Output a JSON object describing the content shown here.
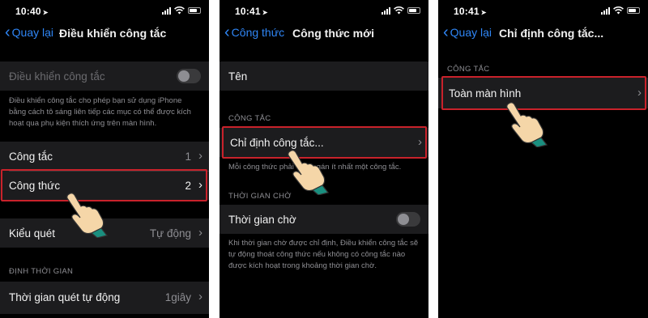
{
  "screen1": {
    "time": "10:40",
    "back": "Quay lại",
    "title": "Điều khiển công tắc",
    "switch_control_label": "Điều khiển công tắc",
    "description": "Điều khiển công tắc cho phép bạn sử dụng iPhone bằng cách tô sáng liên tiếp các mục có thể được kích hoạt qua phụ kiện thích ứng trên màn hình.",
    "switches_label": "Công tắc",
    "switches_value": "1",
    "recipes_label": "Công thức",
    "recipes_value": "2",
    "scan_style_label": "Kiểu quét",
    "scan_style_value": "Tự động",
    "timing_header": "ĐỊNH THỜI GIAN",
    "auto_scan_label": "Thời gian quét tự động",
    "auto_scan_value": "1giây"
  },
  "screen2": {
    "time": "10:41",
    "back": "Công thức",
    "title": "Công thức mới",
    "name_label": "Tên",
    "switch_header": "CÔNG TẮC",
    "assign_label": "Chỉ định công tắc...",
    "assign_footer": "Mỗi công thức phải được gán ít nhất một công tắc.",
    "timeout_header": "THỜI GIAN CHỜ",
    "timeout_label": "Thời gian chờ",
    "timeout_footer": "Khi thời gian chờ được chỉ định, Điều khiển công tắc sẽ tự động thoát công thức nếu không có công tắc nào được kích hoạt trong khoảng thời gian chờ."
  },
  "screen3": {
    "time": "10:41",
    "back": "Quay lại",
    "title": "Chỉ định công tắc...",
    "switch_header": "CÔNG TẮC",
    "fullscreen_label": "Toàn màn hình"
  },
  "colors": {
    "accent": "#2f86f6",
    "highlight": "#c9222b",
    "cell": "#1c1c1e",
    "hand_skin": "#f5d6a8",
    "hand_cuff": "#1a8f7f"
  },
  "icons": [
    "location-arrow-icon",
    "signal-icon",
    "wifi-icon",
    "battery-icon",
    "back-chevron-icon",
    "disclosure-chevron-icon",
    "pointing-hand-icon"
  ]
}
